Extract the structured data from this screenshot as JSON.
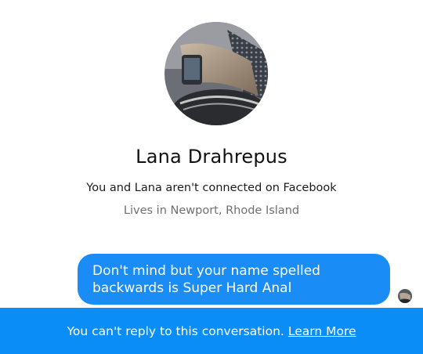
{
  "profile": {
    "name": "Lana Drahrepus",
    "connection_status": "You and Lana aren't connected on Facebook",
    "location": "Lives in Newport, Rhode Island",
    "photo_icon": "profile-photo"
  },
  "conversation": {
    "message_lines": [
      "Don't mind but your name spelled",
      "backwards is Super Hard Anal"
    ],
    "read_receipt_icon": "read-avatar"
  },
  "footer": {
    "notice": "You can't reply to this conversation.",
    "link_label": "Learn More"
  },
  "colors": {
    "bubble": "#1a8cf5",
    "banner": "#0a8df6",
    "secondary_text": "#6f6f6f"
  }
}
